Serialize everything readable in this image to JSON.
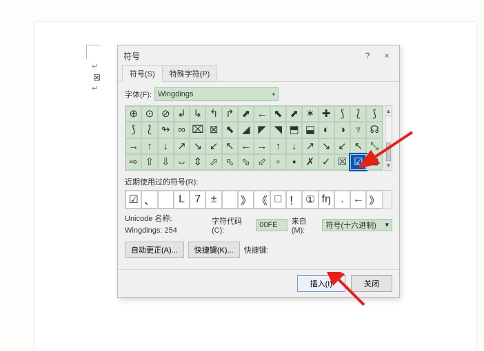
{
  "domain": "Computer-Use",
  "dialog": {
    "title": "符号",
    "help": "?",
    "close": "×",
    "tabs": [
      {
        "label": "符号(S)",
        "active": true
      },
      {
        "label": "特殊字符(P)",
        "active": false
      }
    ],
    "font_label": "字体(F):",
    "font_value": "Wingdings",
    "grid_rows": [
      [
        "⊕",
        "⊙",
        "⊘",
        "↲",
        "↳",
        "↰",
        "↱",
        "⬈",
        "←",
        "⬉",
        "⬈",
        "✶",
        "✚",
        "⟆",
        "⟅",
        "⟆"
      ],
      [
        "⟆",
        "⟅",
        "↬",
        "∞",
        "⌧",
        "⊠",
        "⬉",
        "◢",
        "◤",
        "◥",
        "⬒",
        "⬓",
        "◐",
        "◑",
        "♆",
        "☊"
      ],
      [
        "→",
        "↑",
        "↓",
        "↗",
        "↘",
        "↙",
        "↖",
        "←",
        "→",
        "↑",
        "↓",
        "↗",
        "↘",
        "↙",
        "↖",
        "⤡"
      ],
      [
        "⇨",
        "⇧",
        "⇩",
        "⇔",
        "⇕",
        "⬀",
        "⬁",
        "⬂",
        "⬃",
        "▫",
        "▪",
        "✗",
        "✓",
        "☒",
        "☑",
        "⊞"
      ]
    ],
    "selected_index": [
      3,
      14
    ],
    "recent_label": "近期使用过的符号(R):",
    "recent": [
      "☑",
      "、",
      "",
      "L",
      "7",
      "±",
      "",
      "》",
      "《",
      "□",
      "！",
      "①",
      "fŋ",
      ".",
      "←",
      "》"
    ],
    "unicode_name_label": "Unicode 名称:",
    "unicode_name_value": "Wingdings: 254",
    "char_code_label": "字符代码(C):",
    "char_code_value": "00FE",
    "from_label": "来自(M):",
    "from_value": "符号(十六进制)",
    "autocorrect_btn": "自动更正(A)...",
    "shortcut_btn": "快捷键(K)...",
    "shortcut_label": "快捷键:",
    "insert_btn": "插入(I)",
    "close_btn": "关闭"
  },
  "doc_background": {
    "mark1": "↵",
    "mark2": "☒",
    "mark3": "↵"
  }
}
